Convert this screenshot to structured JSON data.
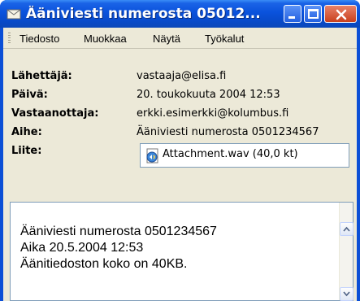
{
  "window": {
    "title": "Ääniviesti numerosta 05012..."
  },
  "menu": [
    "Tiedosto",
    "Muokkaa",
    "Näytä",
    "Työkalut"
  ],
  "headers": [
    {
      "label": "Lähettäjä:",
      "value": "vastaaja@elisa.fi"
    },
    {
      "label": "Päivä:",
      "value": "20. toukokuuta 2004 12:53"
    },
    {
      "label": "Vastaanottaja:",
      "value": "erkki.esimerkki@kolumbus.fi"
    },
    {
      "label": "Aihe:",
      "value": "Ääniviesti numerosta 0501234567"
    },
    {
      "label": "Liite:",
      "value": ""
    }
  ],
  "attachment": {
    "label": "Attachment.wav (40,0 kt)",
    "icon": "wav-file-icon"
  },
  "body": {
    "lines": [
      "Ääniviesti numerosta 0501234567",
      "Aika 20.5.2004 12:53",
      "Äänitiedoston koko on 40KB."
    ]
  },
  "colors": {
    "titlebar": "#0a52dc",
    "client": "#ece9d8",
    "close_button": "#d9532f"
  }
}
